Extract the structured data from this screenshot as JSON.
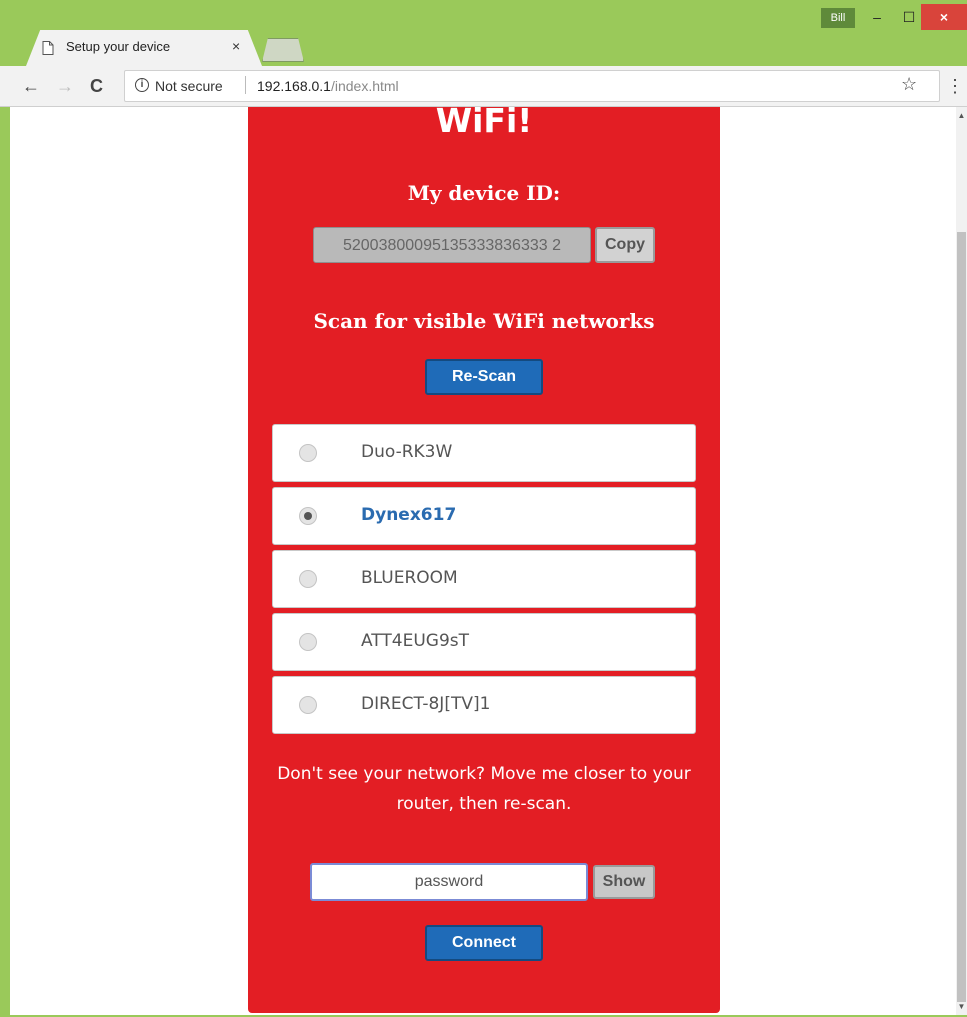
{
  "window": {
    "user_badge": "Bill",
    "minimize_glyph": "–",
    "maximize_glyph": "☐",
    "close_glyph": "×"
  },
  "tab": {
    "title": "Setup your device",
    "close_glyph": "×"
  },
  "toolbar": {
    "back_glyph": "←",
    "forward_glyph": "→",
    "reload_glyph": "C",
    "security_text": "Not secure",
    "url_host": "192.168.0.1",
    "url_path": "/index.html",
    "star_glyph": "☆",
    "menu_glyph": "⋮"
  },
  "page": {
    "title": "WiFi!",
    "device_label": "My device ID:",
    "device_id": "52003800095135333836333 2",
    "copy_label": "Copy",
    "scan_label": "Scan for visible WiFi networks",
    "rescan_label": "Re-Scan",
    "networks": [
      {
        "name": "Duo-RK3W",
        "selected": false
      },
      {
        "name": "Dynex617",
        "selected": true
      },
      {
        "name": "BLUEROOM",
        "selected": false
      },
      {
        "name": "ATT4EUG9sT",
        "selected": false
      },
      {
        "name": "DIRECT-8J[TV]1",
        "selected": false
      }
    ],
    "help_text": "Don't see your network? Move me closer to your router, then re-scan.",
    "password_value": "password",
    "show_label": "Show",
    "connect_label": "Connect"
  },
  "colors": {
    "card_red": "#e31e24",
    "button_blue": "#1f6bb8",
    "selected_network": "#2a6bb0",
    "chrome_green": "#9ac95a"
  }
}
